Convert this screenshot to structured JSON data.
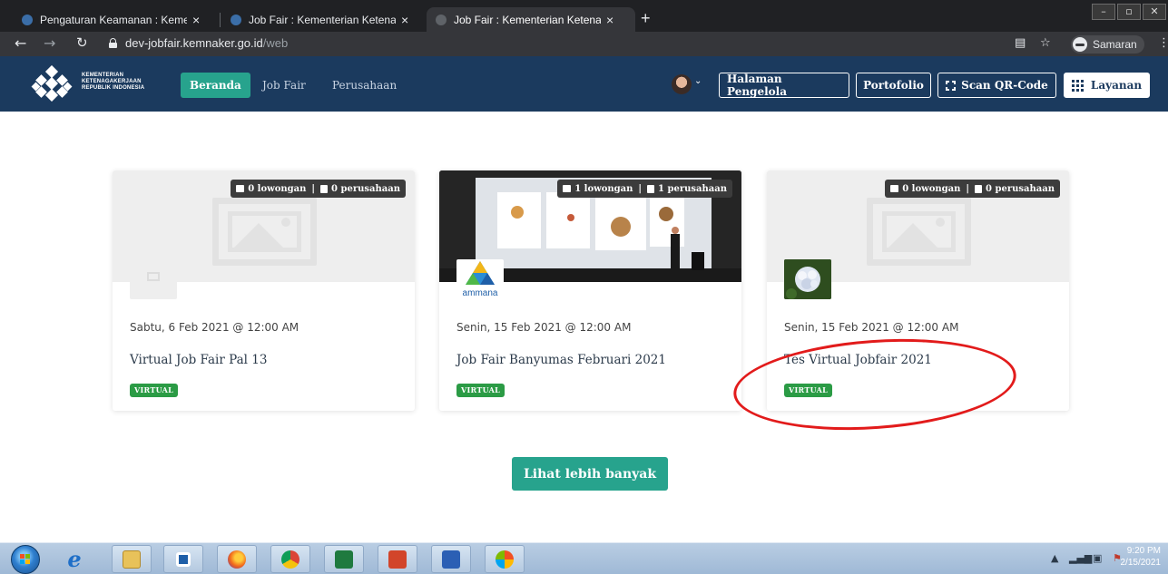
{
  "browser": {
    "tabs": [
      {
        "title": "Pengaturan Keamanan : Kementerian",
        "active": false
      },
      {
        "title": "Job Fair : Kementerian Ketenagakerjaan",
        "active": false
      },
      {
        "title": "Job Fair : Kementerian Ketenagakerjaan",
        "active": true
      }
    ],
    "tab_close_glyph": "×",
    "new_tab_glyph": "+",
    "url_host": "dev-jobfair.kemnaker.go.id",
    "url_path": "/web",
    "profile_label": "Samaran"
  },
  "header": {
    "logo_lines": [
      "KEMENTERIAN",
      "KETENAGAKERJAAN",
      "REPUBLIK INDONESIA"
    ],
    "nav": [
      {
        "label": "Beranda",
        "active": true
      },
      {
        "label": "Job Fair",
        "active": false
      },
      {
        "label": "Perusahaan",
        "active": false
      }
    ],
    "buttons": {
      "admin": "Halaman Pengelola",
      "portfolio": "Portofolio",
      "scan_qr": "Scan QR-Code",
      "services": "Layanan"
    }
  },
  "events": [
    {
      "date": "Sabtu, 6 Feb 2021 @ 12:00 AM",
      "title": "Virtual Job Fair Pal 13",
      "badge": "VIRTUAL",
      "vacancies": "0 lowongan",
      "companies": "0 perusahaan",
      "cover": "placeholder",
      "logo": "placeholder"
    },
    {
      "date": "Senin, 15 Feb 2021 @ 12:00 AM",
      "title": "Job Fair Banyumas Februari 2021",
      "badge": "VIRTUAL",
      "vacancies": "1 lowongan",
      "companies": "1 perusahaan",
      "cover": "photo-presentation",
      "logo": "ammana",
      "logo_text": "ammana"
    },
    {
      "date": "Senin, 15 Feb 2021 @ 12:00 AM",
      "title": "Tes Virtual Jobfair 2021",
      "badge": "VIRTUAL",
      "vacancies": "0 lowongan",
      "companies": "0 perusahaan",
      "cover": "placeholder",
      "logo": "flower-photo"
    }
  ],
  "more_button": "Lihat lebih banyak",
  "annotation": {
    "shape": "ellipse",
    "color": "#e21b1b",
    "target": "Tes Virtual Jobfair 2021"
  },
  "taskbar": {
    "apps": [
      "internet-explorer",
      "file-explorer",
      "outlook",
      "firefox",
      "chrome",
      "excel",
      "powerpoint",
      "word",
      "paint"
    ],
    "clock_time": "9:20 PM",
    "clock_date": "2/15/2021"
  },
  "colors": {
    "header_bg": "#1b3a5e",
    "accent_teal": "#27a38d",
    "virtual_badge": "#2b9b45",
    "annotation_red": "#e21b1b"
  }
}
